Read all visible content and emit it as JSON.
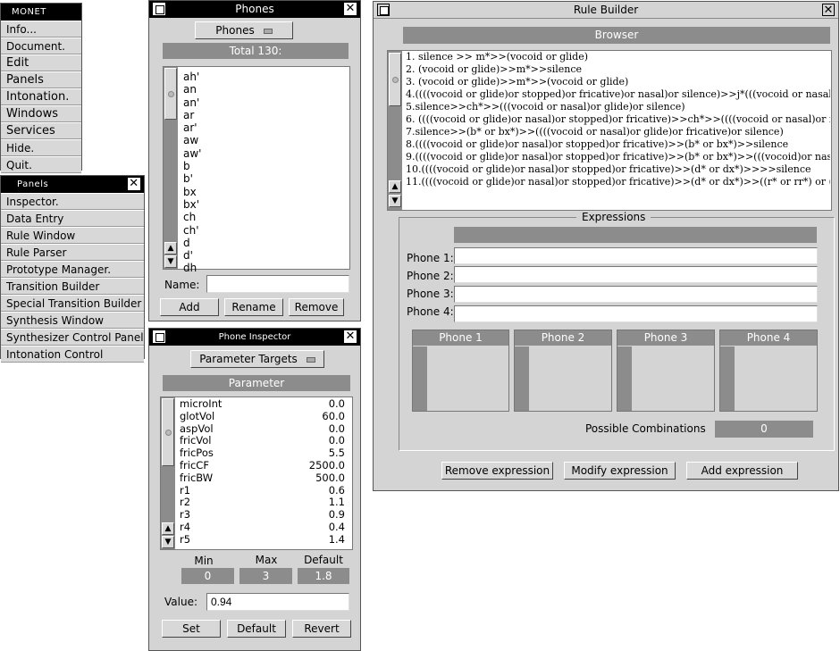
{
  "main_menu": {
    "title": "MONET",
    "items": [
      "Info...",
      "Document.",
      "Edit",
      "Panels",
      "Intonation.",
      "Windows",
      "Services",
      "Hide.",
      "Quit."
    ]
  },
  "panels_menu": {
    "title": "Panels",
    "items": [
      "Inspector.",
      "Data Entry",
      "Rule Window",
      "Rule Parser",
      "Prototype Manager.",
      "Transition Builder",
      "Special Transition Builder",
      "Synthesis Window",
      "Synthesizer Control Panel",
      "Intonation Control"
    ]
  },
  "phones_window": {
    "title": "Phones",
    "popup_value": "Phones",
    "total_label": "Total 130:",
    "phones": [
      "ah'",
      "an",
      "an'",
      "ar",
      "ar'",
      "aw",
      "aw'",
      "b",
      "b'",
      "bx",
      "bx'",
      "ch",
      "ch'",
      "d",
      "d'",
      "dh"
    ],
    "name_label": "Name:",
    "name_value": "",
    "add_label": "Add",
    "rename_label": "Rename",
    "remove_label": "Remove"
  },
  "phone_inspector": {
    "title": "Phone Inspector",
    "popup_value": "Parameter Targets",
    "header": "Parameter",
    "params": [
      {
        "name": "microInt",
        "value": "0.0"
      },
      {
        "name": "glotVol",
        "value": "60.0"
      },
      {
        "name": "aspVol",
        "value": "0.0"
      },
      {
        "name": "fricVol",
        "value": "0.0"
      },
      {
        "name": "fricPos",
        "value": "5.5"
      },
      {
        "name": "fricCF",
        "value": "2500.0"
      },
      {
        "name": "fricBW",
        "value": "500.0"
      },
      {
        "name": "r1",
        "value": "0.6"
      },
      {
        "name": "r2",
        "value": "1.1"
      },
      {
        "name": "r3",
        "value": "0.9"
      },
      {
        "name": "r4",
        "value": "0.4"
      },
      {
        "name": "r5",
        "value": "1.4"
      }
    ],
    "min_label": "Min",
    "max_label": "Max",
    "default_label": "Default",
    "min_value": "0",
    "max_value": "3",
    "default_value": "1.8",
    "value_label": "Value:",
    "value_field": "0.94",
    "set_label": "Set",
    "default_button": "Default",
    "revert_label": "Revert"
  },
  "rule_builder": {
    "title": "Rule Builder",
    "browser_label": "Browser",
    "rules": [
      "1. silence >> m*>>(vocoid or glide)",
      "2. (vocoid or glide)>>m*>>silence",
      "3. (vocoid or glide)>>m*>>(vocoid or glide)",
      "4.((((vocoid or glide)or stopped)or fricative)or nasal)or silence)>>j*(((vocoid or nasal)or nasal)o",
      "5.silence>>ch*>>(((vocoid or nasal)or glide)or silence)",
      "6. ((((vocoid or glide)or nasal)or stopped)or fricative)>>ch*>>((((vocoid or nasal)or fricative)or",
      "7.silence>>(b* or bx*)>>((((vocoid or nasal)or glide)or fricative)or silence)",
      "8.((((vocoid or glide)or nasal)or stopped)or fricative)>>(b* or bx*)>>silence",
      "9.((((vocoid or glide)or nasal)or stopped)or fricative)>>(b* or bx*)>>(((vocoid)or nasal)or frica",
      "10.((((vocoid or glide)or nasal)or stopped)or fricative)>>(d* or dx*)>>>>silence",
      "11.((((vocoid or glide)or nasal)or stopped)or fricative)>>(d* or dx*)>>((r* or rr*) or (l* or ll*))"
    ],
    "expressions_label": "Expressions",
    "phone_field_labels": [
      "Phone 1:",
      "Phone 2:",
      "Phone 3:",
      "Phone 4:"
    ],
    "phone_field_values": [
      "",
      "",
      "",
      ""
    ],
    "phone_columns": [
      "Phone 1",
      "Phone 2",
      "Phone 3",
      "Phone 4"
    ],
    "possible_combinations_label": "Possible Combinations",
    "possible_combinations_value": "0",
    "remove_expression_label": "Remove expression",
    "modify_expression_label": "Modify expression",
    "add_expression_label": "Add expression"
  },
  "icons": {
    "close": "close-icon",
    "miniaturize": "miniaturize-icon",
    "scroll_up": "up-arrow-icon",
    "scroll_down": "down-arrow-icon"
  }
}
